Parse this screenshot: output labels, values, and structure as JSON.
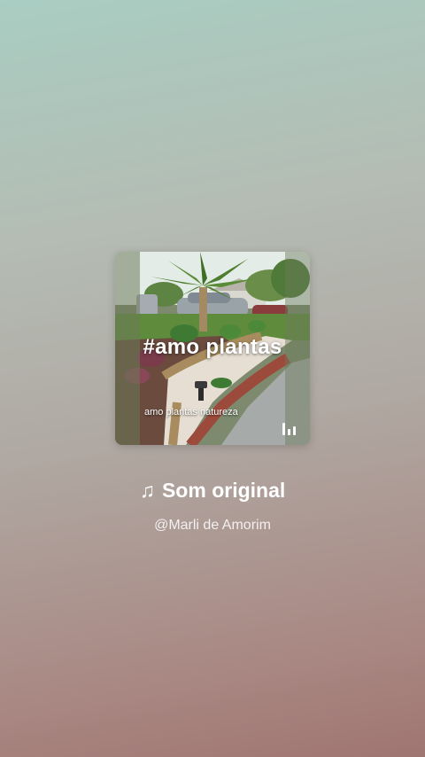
{
  "cover": {
    "hashtag": "#amo plantas",
    "caption": "amo plantas natureza"
  },
  "sound": {
    "title": "Som original",
    "artist": "@Marli de Amorim",
    "icon": "music-note-icon"
  },
  "colors": {
    "text": "#ffffff",
    "bg_top": "#a9cdc2",
    "bg_bottom": "#a07571"
  }
}
